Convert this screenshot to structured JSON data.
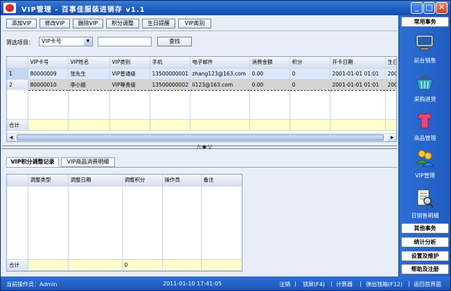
{
  "window": {
    "title": "VIP管理 - 百事佳服装进销存 v1.1",
    "controls": [
      "_",
      "□",
      "✕"
    ]
  },
  "toolbar": {
    "buttons": [
      "添加VIP",
      "修改VIP",
      "删除VIP",
      "积分调整",
      "生日提醒",
      "VIP类别"
    ]
  },
  "filter": {
    "label": "筛选项目：",
    "selected": "VIP卡号",
    "search_value": "",
    "search_button": "查找"
  },
  "vip_table": {
    "columns": [
      "VIP卡号",
      "VIP姓名",
      "VIP类别",
      "手机",
      "电子邮件",
      "消费金额",
      "积分",
      "开卡日期",
      "生日"
    ],
    "rows": [
      {
        "num": "1",
        "cells": [
          "80000009",
          "张先生",
          "VIP普通级",
          "13500000001",
          "zhang123@163.com",
          "0.00",
          "0",
          "2001-01-01 01:01",
          "200"
        ]
      },
      {
        "num": "2",
        "cells": [
          "80000010",
          "李小姐",
          "VIP尊贵级",
          "13500000002",
          "li123@163.com",
          "0.00",
          "0",
          "2001-01-01 01:01",
          "200"
        ]
      }
    ],
    "sum_label": "合计"
  },
  "tabs": [
    "VIP积分调整记录",
    "VIP商品消费明细"
  ],
  "adjust_table": {
    "columns": [
      "调整类型",
      "调整日期",
      "调整积分",
      "操作员",
      "备注"
    ],
    "sum_label": "合计",
    "sum_points": "0"
  },
  "sidebar": {
    "top_button": "常用事务",
    "nav": [
      {
        "label": "前台销售",
        "icon": "monitor-icon"
      },
      {
        "label": "采购进货",
        "icon": "basket-icon"
      },
      {
        "label": "商品管理",
        "icon": "shirt-icon"
      },
      {
        "label": "VIP管理",
        "icon": "users-icon"
      },
      {
        "label": "日销售明细",
        "icon": "report-search-icon"
      }
    ],
    "bottom_buttons": [
      "其他事务",
      "统计分析",
      "设置及维护",
      "帮助及注册"
    ]
  },
  "status": {
    "operator": "当前操作员：Admin",
    "datetime": "2011-01-10 17:41:05",
    "links": [
      "注销",
      "锁屏(F4)",
      "计算器",
      "弹出钱箱(F12)",
      "返回首界面"
    ]
  }
}
